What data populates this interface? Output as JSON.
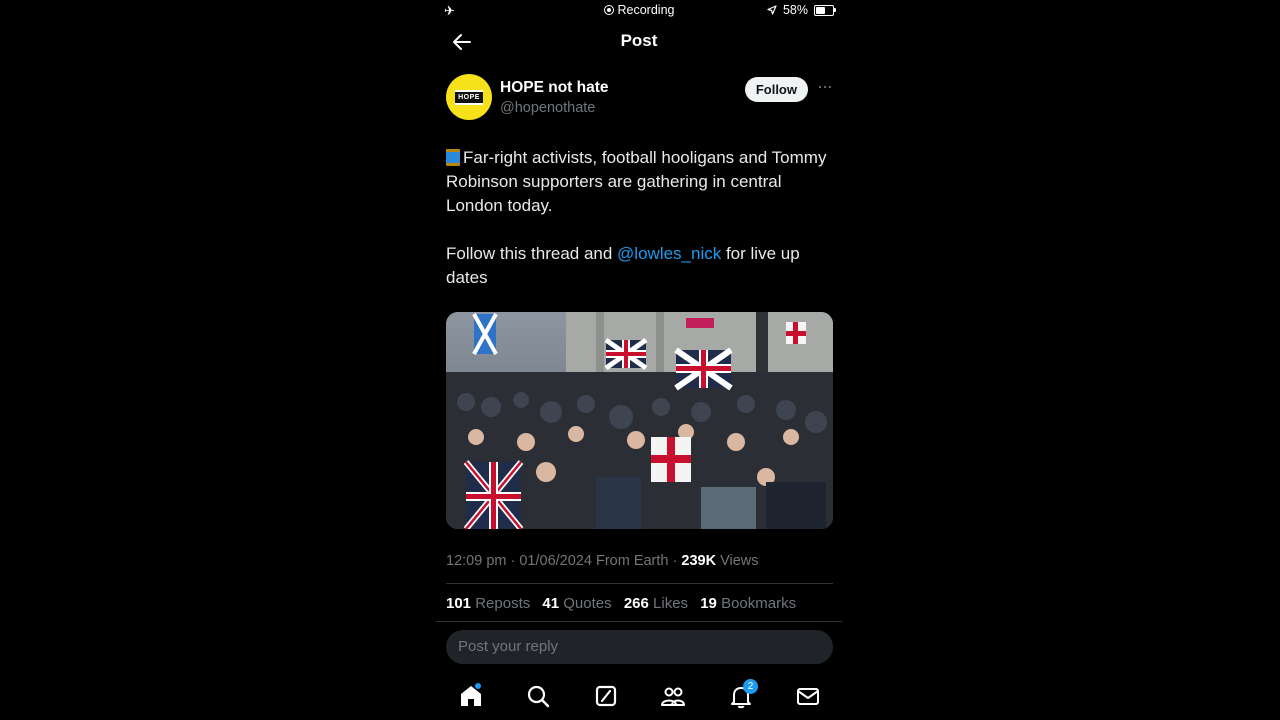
{
  "status_bar": {
    "recording": "Recording",
    "battery": "58%",
    "battery_level": 0.58
  },
  "header": {
    "title": "Post"
  },
  "author": {
    "display_name": "HOPE not hate",
    "handle": "@hopenothate",
    "avatar_text": "HOPE",
    "follow_label": "Follow"
  },
  "tweet": {
    "line1": "Far-right activists, football hooligans and Tommy Robinson supporters are gathering in central London today.",
    "line2_prefix": "Follow this thread and ",
    "mention": "@lowles_nick",
    "line2_suffix": " for live up dates"
  },
  "meta": {
    "time": "12:09 pm",
    "date": "01/06/2024",
    "source": "From Earth",
    "views_count": "239K",
    "views_label": "Views"
  },
  "stats": [
    {
      "count": "101",
      "label": "Reposts"
    },
    {
      "count": "41",
      "label": "Quotes"
    },
    {
      "count": "266",
      "label": "Likes"
    },
    {
      "count": "19",
      "label": "Bookmarks"
    }
  ],
  "reply": {
    "placeholder": "Post your reply"
  },
  "tabbar": {
    "notifications_count": "2"
  },
  "colors": {
    "accent": "#1d9bf0",
    "background": "#000000",
    "muted": "#71767b",
    "avatar_bg": "#f6e11a"
  }
}
